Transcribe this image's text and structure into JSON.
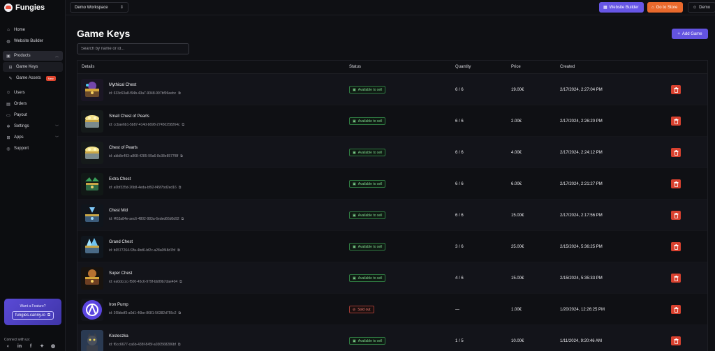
{
  "app": {
    "name": "Fungies"
  },
  "sidebar": {
    "items": [
      {
        "label": "Home",
        "icon": "home-icon"
      },
      {
        "label": "Website Builder",
        "icon": "globe-icon"
      },
      {
        "label": "Products",
        "icon": "box-icon",
        "expanded": true,
        "active": true
      },
      {
        "label": "Game Keys",
        "icon": "key-icon",
        "sub": true,
        "active": true
      },
      {
        "label": "Game Assets",
        "icon": "paint-icon",
        "sub": true,
        "badge": "New"
      },
      {
        "label": "Users",
        "icon": "users-icon"
      },
      {
        "label": "Orders",
        "icon": "orders-icon"
      },
      {
        "label": "Payout",
        "icon": "wallet-icon"
      },
      {
        "label": "Settings",
        "icon": "gear-icon",
        "expandable": true
      },
      {
        "label": "Apps",
        "icon": "apps-icon",
        "expandable": true
      },
      {
        "label": "Support",
        "icon": "support-icon"
      }
    ],
    "feature": {
      "title": "Want a Feature?",
      "link": "fungies.canny.io"
    },
    "connect_label": "Connect with us:"
  },
  "topbar": {
    "workspace": "Demo Workspace",
    "website_builder": "Website Builder",
    "go_to_store": "Go to Store",
    "user": "Demo"
  },
  "page": {
    "title": "Game Keys",
    "add_button": "Add Game",
    "search_placeholder": "Search by name or id...",
    "columns": {
      "details": "Details",
      "status": "Status",
      "quantity": "Quantity",
      "price": "Price",
      "created": "Created"
    }
  },
  "rows": [
    {
      "name": "Mythical Chest",
      "id": "id: 633c63a8-f94b-43a7-9048-997bf96eebc",
      "status": "Available to sell",
      "quantity": "6 / 6",
      "price": "19.00€",
      "created": "2/17/2024, 2:27:04 PM",
      "thumb": "chest-purple"
    },
    {
      "name": "Small Chest of Pearls",
      "id": "id: ccbae6b1-5b87-414d-b698-27450258264c",
      "status": "Available to sell",
      "quantity": "6 / 6",
      "price": "2.00€",
      "created": "2/17/2024, 2:26:20 PM",
      "thumb": "chest-gold"
    },
    {
      "name": "Chest of Pearls",
      "id": "id: abb8e493-a868-4285-99a6-8c38e8577f8f",
      "status": "Available to sell",
      "quantity": "6 / 6",
      "price": "4.00€",
      "created": "2/17/2024, 2:24:12 PM",
      "thumb": "chest-gold"
    },
    {
      "name": "Extra Chest",
      "id": "id: a0bf335d-26b8-4eda-bf92-f45f7bd2ed16",
      "status": "Available to sell",
      "quantity": "6 / 6",
      "price": "6.00€",
      "created": "2/17/2024, 2:21:27 PM",
      "thumb": "chest-green"
    },
    {
      "name": "Chest Mid",
      "id": "id: f453a84e-aec6-4802-983a-6eded66d0d92",
      "status": "Available to sell",
      "quantity": "6 / 6",
      "price": "15.00€",
      "created": "2/17/2024, 2:17:56 PM",
      "thumb": "chest-blue"
    },
    {
      "name": "Grand Chest",
      "id": "id: b6577264-f2fa-4bd6-bf2c-a28a0f48d7bf",
      "status": "Available to sell",
      "quantity": "3 / 6",
      "price": "25.00€",
      "created": "2/15/2024, 5:36:25 PM",
      "thumb": "chest-crystal"
    },
    {
      "name": "Super Chest",
      "id": "id: ea0dcccc-f500-45c6-979f-bb89b7dae404",
      "status": "Available to sell",
      "quantity": "4 / 6",
      "price": "15.00€",
      "created": "2/15/2024, 5:35:33 PM",
      "thumb": "chest-orange"
    },
    {
      "name": "Iron Pump",
      "id": "id: 3f3bbdf3-a0d1-46be-8681-56382d755c2",
      "status": "Sold out",
      "quantity": "—",
      "price": "1.00€",
      "created": "1/20/2024, 12:26:25 PM",
      "thumb": "logo-circle"
    },
    {
      "name": "Kosteczka",
      "id": "id: f6cc6677-ca6b-438f-845f-a030568286bf",
      "status": "Available to sell",
      "quantity": "1 / 5",
      "price": "10.00€",
      "created": "1/11/2024, 9:20:46 AM",
      "thumb": "cat-photo"
    }
  ],
  "colors": {
    "accent": "#6756e6",
    "store": "#e9692c",
    "delete": "#d8412f",
    "available": "#7fd68e",
    "sold_out": "#ef7d72"
  }
}
